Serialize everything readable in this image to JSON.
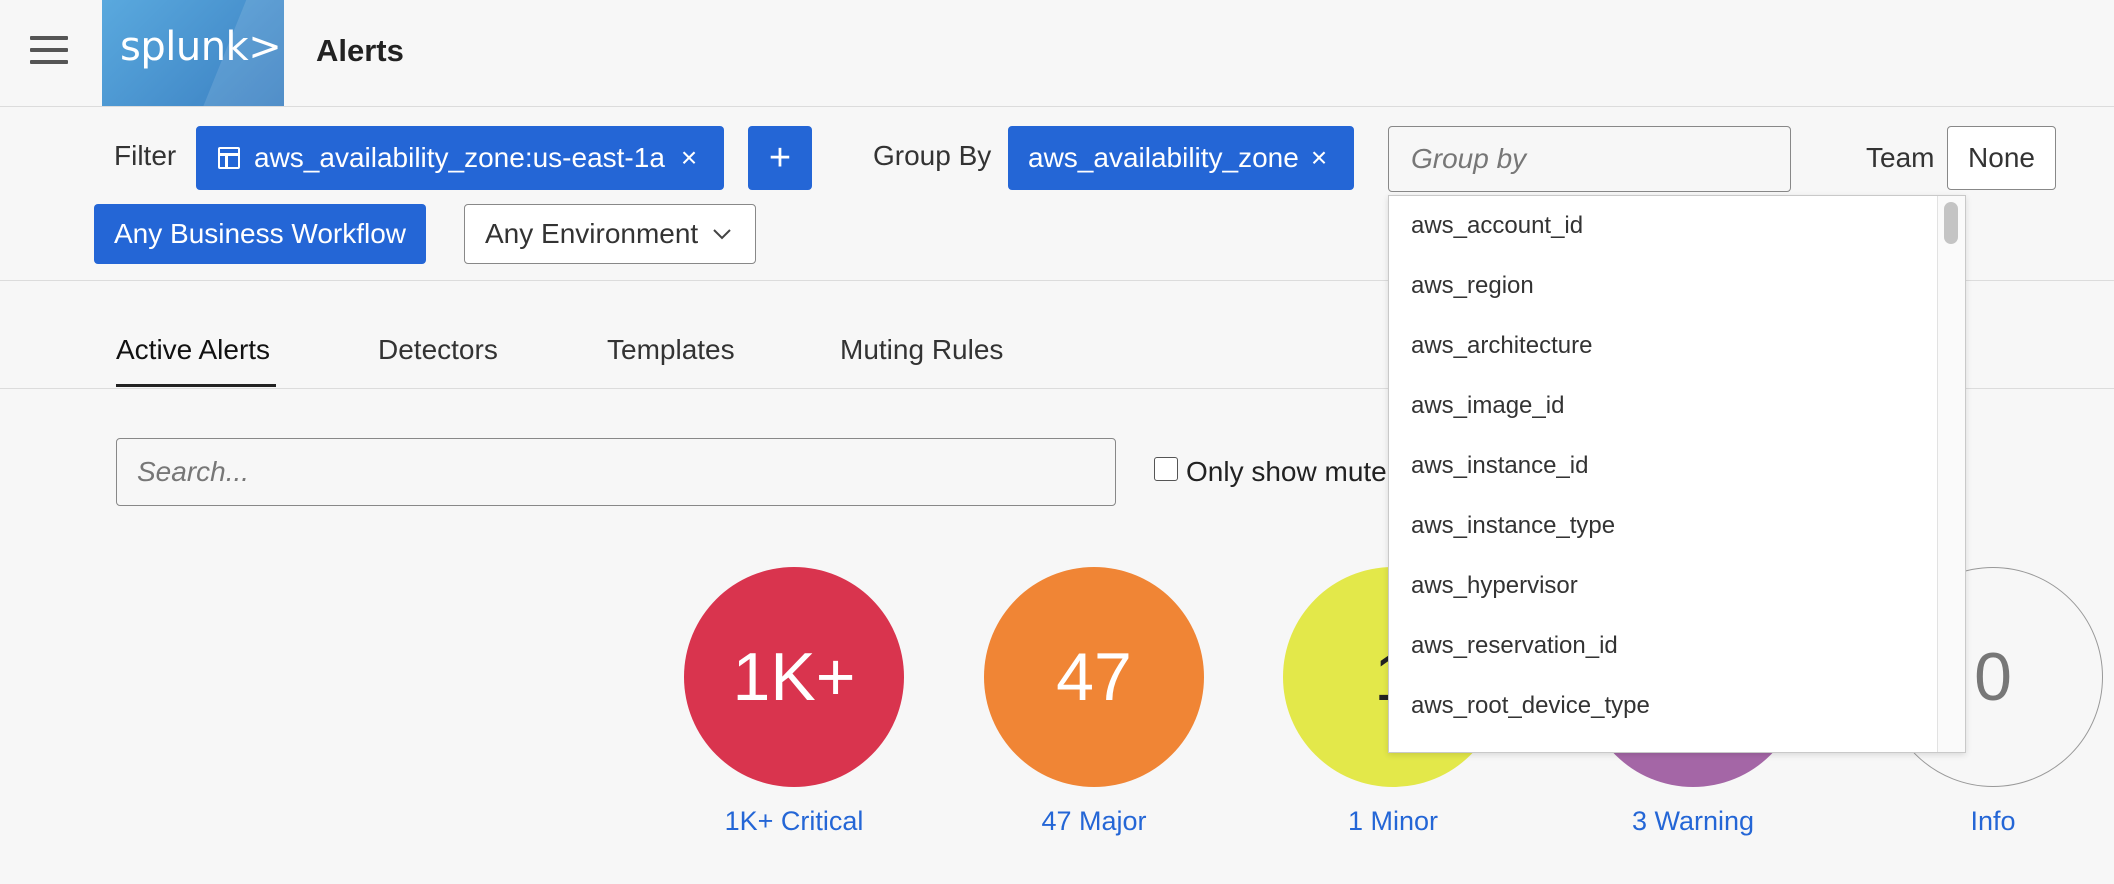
{
  "app": {
    "logo_text": "splunk>",
    "title": "Alerts"
  },
  "filters": {
    "filter_label": "Filter",
    "filter_chip": "aws_availability_zone:us-east-1a",
    "remove_symbol": "×",
    "add_label": "+",
    "group_by_label": "Group By",
    "group_by_chip": "aws_availability_zone",
    "group_by_placeholder": "Group by",
    "team_label": "Team",
    "team_value": "None",
    "workflow_button": "Any Business Workflow",
    "environment_select": "Any Environment"
  },
  "tabs": [
    {
      "label": "Active Alerts",
      "active": true
    },
    {
      "label": "Detectors",
      "active": false
    },
    {
      "label": "Templates",
      "active": false
    },
    {
      "label": "Muting Rules",
      "active": false
    }
  ],
  "search": {
    "placeholder": "Search...",
    "checkbox_label": "Only show mute"
  },
  "severity": [
    {
      "value": "1K+",
      "label": "1K+ Critical",
      "color": "#d9344e"
    },
    {
      "value": "47",
      "label": "47 Major",
      "color": "#f08535"
    },
    {
      "value": "1",
      "label": "1 Minor",
      "color": "#e3e84a"
    },
    {
      "value": "3",
      "label": "3 Warning",
      "color": "#a466a6"
    },
    {
      "value": "0",
      "label": "Info",
      "color": "#f7f7f7"
    }
  ],
  "group_by_options": [
    "aws_account_id",
    "aws_region",
    "aws_architecture",
    "aws_image_id",
    "aws_instance_id",
    "aws_instance_type",
    "aws_hypervisor",
    "aws_reservation_id",
    "aws_root_device_type"
  ],
  "colors": {
    "accent": "#2466d6"
  }
}
